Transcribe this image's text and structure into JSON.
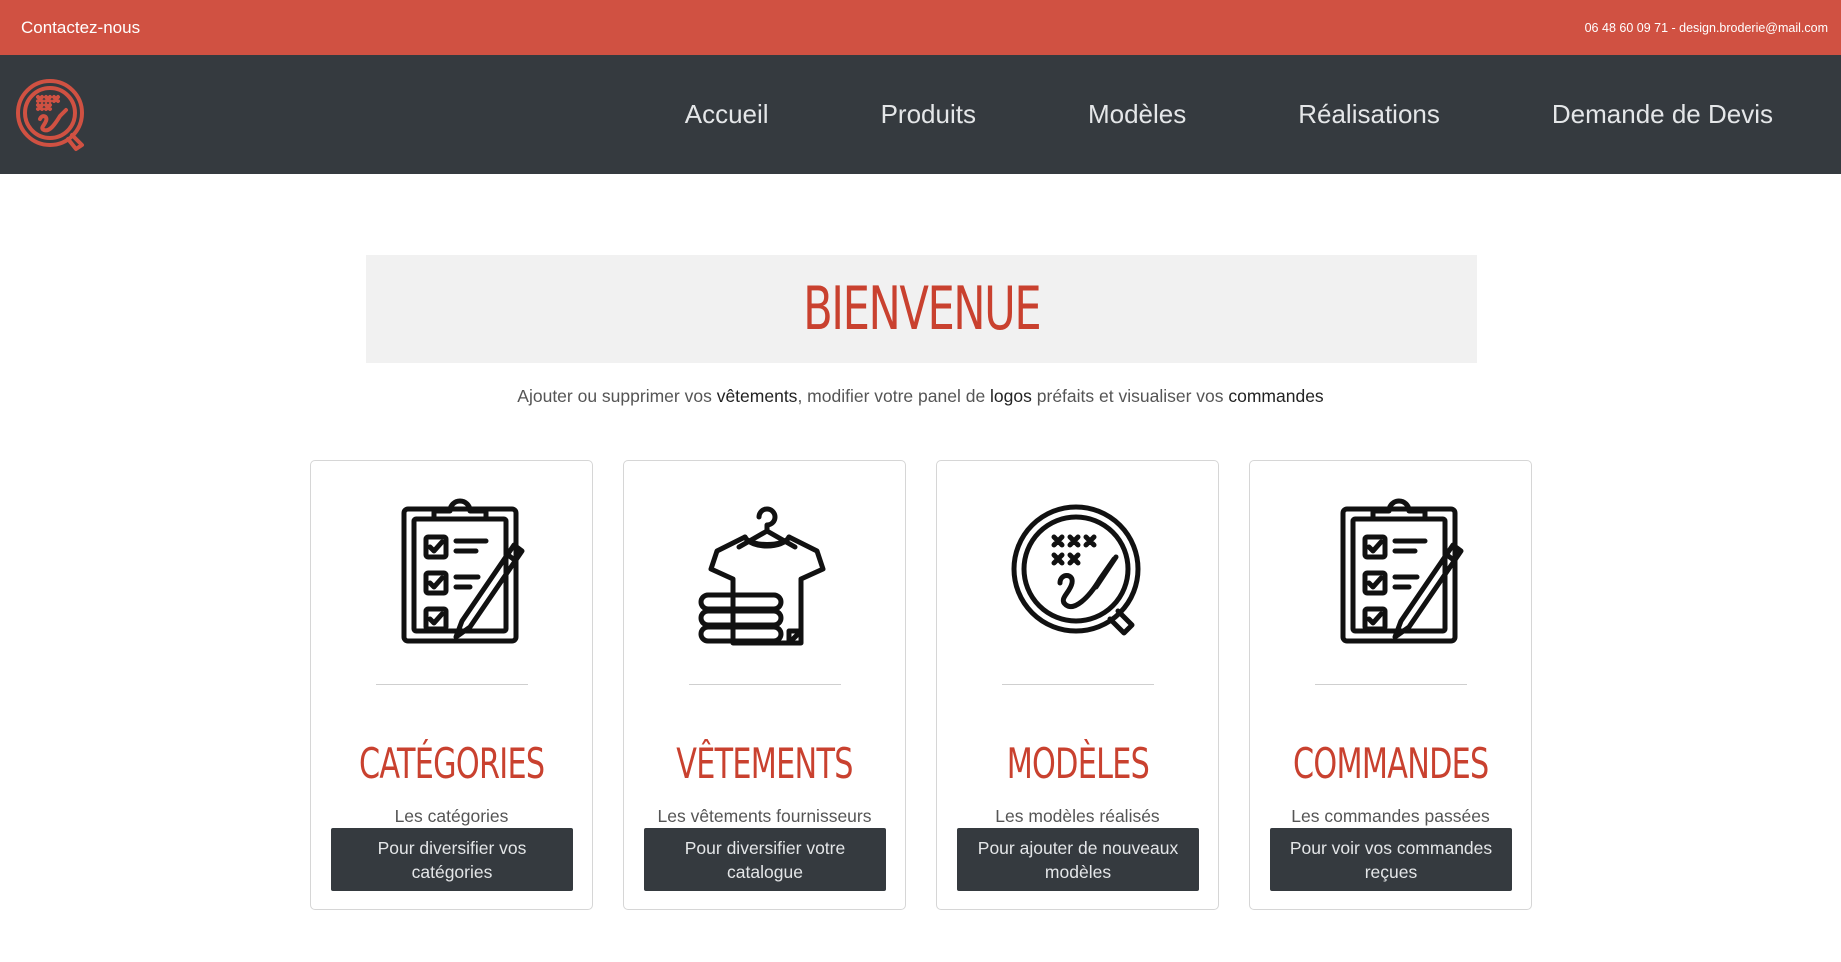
{
  "topbar": {
    "contact": "Contactez-nous",
    "info": "06 48 60 09 71 - design.broderie@mail.com"
  },
  "nav": {
    "logo": "logo-embroidery-icon",
    "items": [
      "Accueil",
      "Produits",
      "Modèles",
      "Réalisations",
      "Demande de Devis"
    ]
  },
  "hero": {
    "title": "BIENVENUE"
  },
  "intro": {
    "p1": "Ajouter ou supprimer vos ",
    "b1": "vêtements",
    "p2": ", modifier votre panel de ",
    "b2": "logos",
    "p3": " préfaits et visualiser vos ",
    "b3": "commandes"
  },
  "cards": [
    {
      "icon": "clipboard-checklist-icon",
      "title": "CATÉGORIES",
      "subtitle": "Les catégories",
      "button": "Pour diversifier vos catégories"
    },
    {
      "icon": "tshirt-hanger-icon",
      "title": "VÊTEMENTS",
      "subtitle": "Les vêtements fournisseurs",
      "button": "Pour diversifier votre catalogue"
    },
    {
      "icon": "embroidery-hoop-icon",
      "title": "MODÈLES",
      "subtitle": "Les modèles réalisés",
      "button": "Pour ajouter de nouveaux modèles"
    },
    {
      "icon": "clipboard-checklist-icon",
      "title": "COMMANDES",
      "subtitle": "Les commandes passées",
      "button": "Pour voir vos commandes reçues"
    }
  ],
  "colors": {
    "accent": "#d05142",
    "title": "#c9412f",
    "dark": "#353a3f",
    "hero_bg": "#f1f1f1"
  }
}
